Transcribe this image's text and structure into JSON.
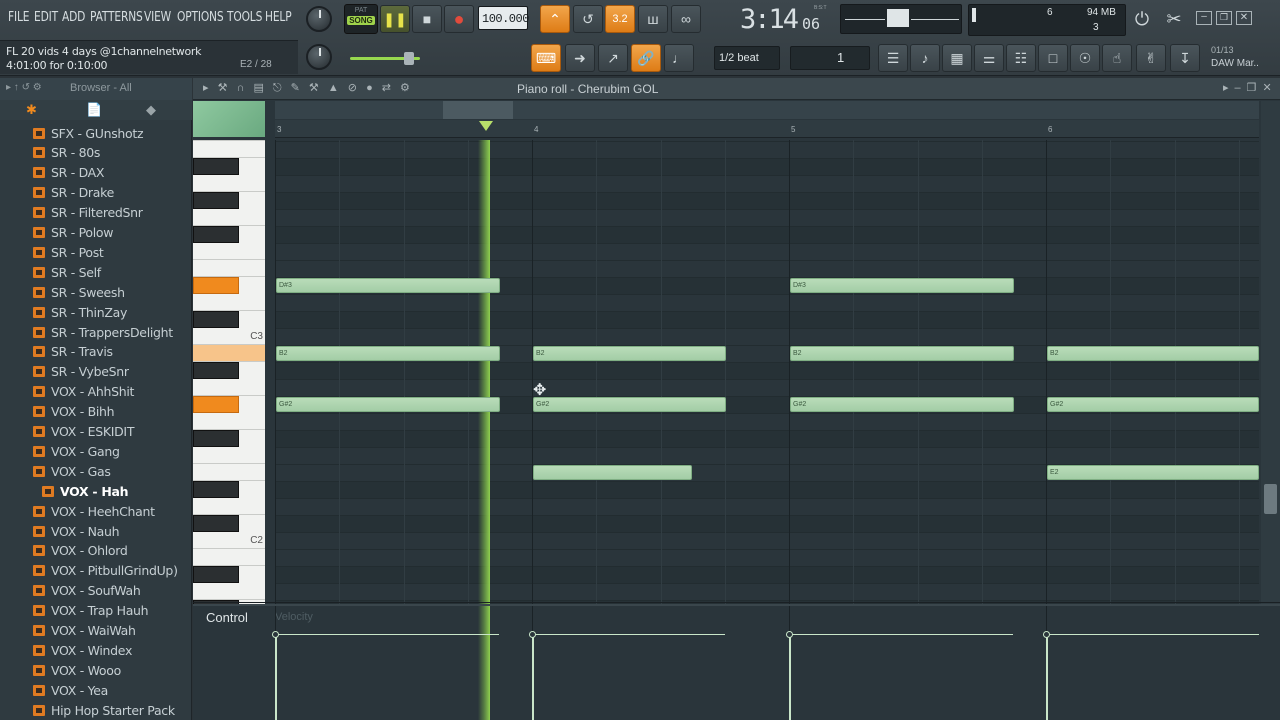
{
  "menu": [
    "FILE",
    "EDIT",
    "ADD",
    "PATTERNS",
    "VIEW",
    "OPTIONS",
    "TOOLS",
    "HELP"
  ],
  "project": {
    "title": "FL 20 vids 4 days @1channelnetwork",
    "time_info": "4:01:00 for 0:10:00",
    "hint": "E2 / 28"
  },
  "transport": {
    "mode_top": "PAT",
    "mode_bottom": "SONG",
    "tempo": "100.000",
    "pattern_number": "3.2"
  },
  "clock": {
    "time": "3:14",
    "sub": "06",
    "label": "B:S:T"
  },
  "monitor": {
    "memory": "94 MB",
    "voices": "3",
    "cpu": "6"
  },
  "snap": {
    "value": "1/2 beat",
    "channel": "1"
  },
  "news": {
    "date": "01/13",
    "text": "DAW Mar.."
  },
  "browser": {
    "header": "Browser - All",
    "items": [
      "SFX - GUnshotz",
      "SR - 80s",
      "SR - DAX",
      "SR - Drake",
      "SR - FilteredSnr",
      "SR - Polow",
      "SR - Post",
      "SR - Self",
      "SR - Sweesh",
      "SR - ThinZay",
      "SR - TrappersDelight",
      "SR - Travis",
      "SR - VybeSnr",
      "VOX - AhhShit",
      "VOX - Bihh",
      "VOX - ESKIDIT",
      "VOX - Gang",
      "VOX - Gas",
      "VOX - Hah",
      "VOX - HeehChant",
      "VOX - Nauh",
      "VOX - Ohlord",
      "VOX - PitbullGrindUp)",
      "VOX - SoufWah",
      "VOX - Trap Hauh",
      "VOX - WaiWah",
      "VOX - Windex",
      "VOX - Wooo",
      "VOX - Yea",
      "Hip Hop Starter Pack"
    ],
    "selected": "VOX - Hah"
  },
  "piano_roll": {
    "title": "Piano roll - Cherubim GOL",
    "bars": [
      "3",
      "4",
      "5",
      "6"
    ],
    "key_labels": [
      "C3",
      "C2"
    ],
    "notes": [
      {
        "pitch": "D#3",
        "bar": 3,
        "len": 0.87
      },
      {
        "pitch": "D#3",
        "bar": 5,
        "len": 0.87
      },
      {
        "pitch": "B2",
        "bar": 3,
        "len": 0.87
      },
      {
        "pitch": "B2",
        "bar": 4,
        "len": 0.75
      },
      {
        "pitch": "B2",
        "bar": 5,
        "len": 0.87
      },
      {
        "pitch": "B2",
        "bar": 6,
        "len": 0.84
      },
      {
        "pitch": "G#2",
        "bar": 3,
        "len": 0.87
      },
      {
        "pitch": "G#2",
        "bar": 4,
        "len": 0.75
      },
      {
        "pitch": "G#2",
        "bar": 5,
        "len": 0.87
      },
      {
        "pitch": "G#2",
        "bar": 6,
        "len": 0.84
      },
      {
        "pitch": "E2",
        "bar": 4,
        "len": 0.62
      },
      {
        "pitch": "E2",
        "bar": 6,
        "len": 0.84
      }
    ],
    "playhead_bar": 3.82,
    "control_label": "Control",
    "control_param": "Velocity"
  },
  "colors": {
    "accent": "#f08a1e",
    "note": "#acd3ae",
    "grid": "#2a353b",
    "playhead": "#7fc04a"
  }
}
